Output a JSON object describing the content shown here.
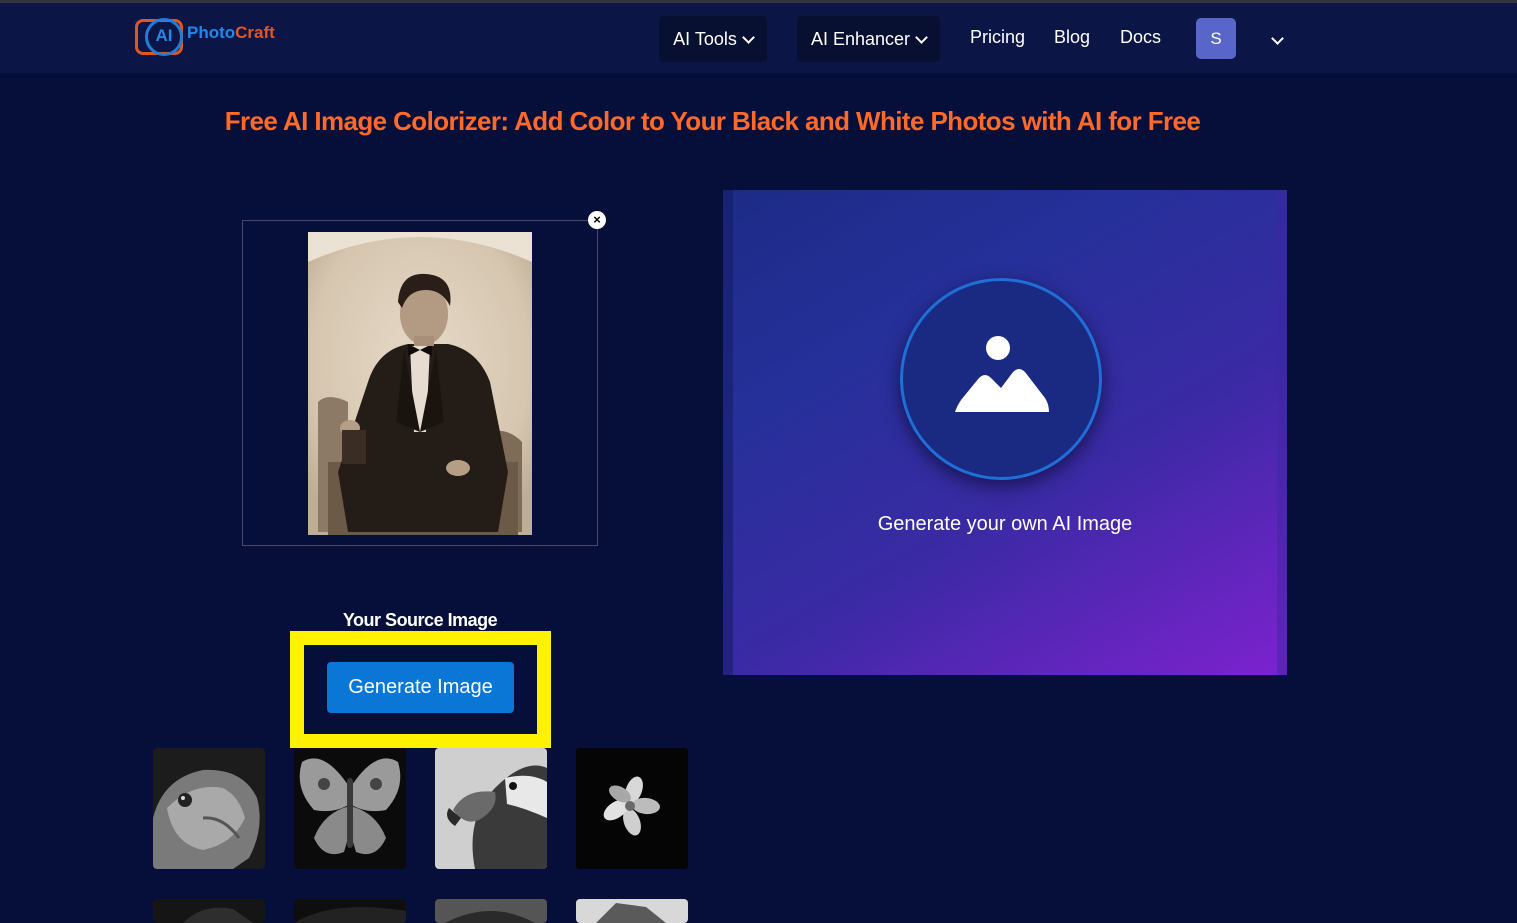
{
  "brand": {
    "logo_badge": "AI",
    "name_part1": "Photo",
    "name_part2": "Craft"
  },
  "nav": {
    "ai_tools": "AI Tools",
    "ai_enhancer": "AI Enhancer",
    "pricing": "Pricing",
    "blog": "Blog",
    "docs": "Docs",
    "user_initial": "S"
  },
  "page": {
    "title": "Free AI Image Colorizer: Add Color to Your Black and White Photos with AI for Free"
  },
  "source": {
    "label": "Your Source Image",
    "remove_icon": "×",
    "generate_button": "Generate Image"
  },
  "result": {
    "placeholder_text": "Generate your own AI Image",
    "icon": "image-placeholder-icon"
  },
  "samples": [
    {
      "name": "iguana"
    },
    {
      "name": "butterfly"
    },
    {
      "name": "eagle"
    },
    {
      "name": "flower"
    },
    {
      "name": "sample-5"
    },
    {
      "name": "sample-6"
    },
    {
      "name": "sample-7"
    },
    {
      "name": "sample-8"
    }
  ],
  "colors": {
    "background": "#060e3a",
    "navbar": "#0b1546",
    "title": "#ff6a2b",
    "button": "#0a76d6",
    "highlight": "#fff200",
    "avatar": "#5966c9"
  }
}
